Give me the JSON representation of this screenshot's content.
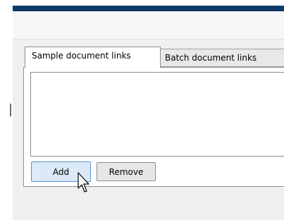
{
  "tabs": [
    {
      "label": "Sample document links",
      "active": true
    },
    {
      "label": "Batch document links",
      "active": false
    }
  ],
  "buttons": {
    "add_label": "Add",
    "remove_label": "Remove"
  },
  "icons": {
    "cursor": "mouse-pointer-arrow-icon"
  },
  "colors": {
    "title_bar": "#0e3a6a",
    "add_button_border": "#5a8fcf",
    "add_button_fill": "#dbe9f8"
  }
}
